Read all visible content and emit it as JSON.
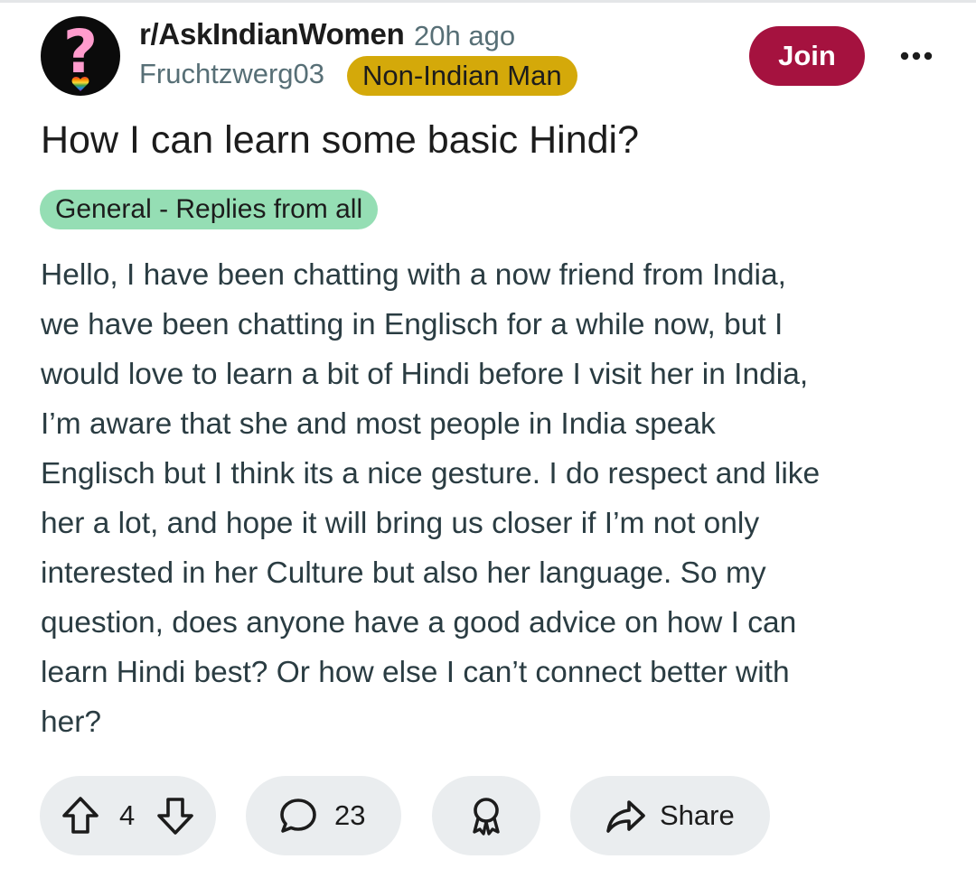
{
  "post": {
    "subreddit": "r/AskIndianWomen",
    "time_ago": "20h ago",
    "author": "Fruchtzwerg03",
    "user_flair": "Non-Indian Man",
    "join_label": "Join",
    "title": "How I can learn some basic Hindi?",
    "post_flair": "General - Replies from all",
    "body_lines": [
      "Hello, I have been chatting with a now friend from India,",
      "we have been chatting in Englisch for a while now, but I",
      "would love to learn a bit of Hindi before I visit her in India,",
      "I’m aware that she and most people in India speak",
      "Englisch but I think its a nice gesture. I do respect and like",
      "her a lot, and hope it will bring us closer if I’m not only",
      "interested in her Culture but also her language. So my",
      "question, does anyone have a good advice on how I can",
      "learn Hindi best? Or how else I can’t connect better with",
      "her?"
    ],
    "avatar_glyph": "?"
  },
  "actions": {
    "vote_count": "4",
    "comment_count": "23",
    "share_label": "Share"
  },
  "icons": {
    "avatar": "question-mark-avatar",
    "more": "more-dots-icon",
    "upvote": "arrow-up-icon",
    "downvote": "arrow-down-icon",
    "comment": "speech-bubble-icon",
    "award": "award-ribbon-icon",
    "share": "share-arrow-icon"
  },
  "colors": {
    "join_button": "#a5123f",
    "user_flair": "#d4a90a",
    "post_flair": "#95deb4",
    "action_pill": "#eaedef",
    "meta_text": "#576f76",
    "body_text": "#2a3c42",
    "avatar_bg": "#0b0b0b",
    "avatar_glyph": "#ff9ccd"
  }
}
